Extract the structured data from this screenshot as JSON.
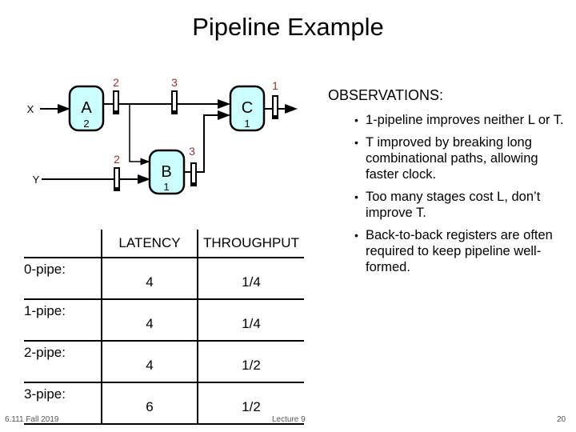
{
  "slide": {
    "title": "Pipeline Example",
    "footer": {
      "course": "6.111 Fall 2019",
      "lecture": "Lecture 9",
      "page": "20"
    }
  },
  "diagram": {
    "inputs": [
      {
        "id": "X",
        "label": "X"
      },
      {
        "id": "Y",
        "label": "Y"
      }
    ],
    "blocks": [
      {
        "id": "A",
        "label": "A",
        "delay": "2"
      },
      {
        "id": "B",
        "label": "B",
        "delay": "1"
      },
      {
        "id": "C",
        "label": "C",
        "delay": "1"
      }
    ],
    "registers": [
      {
        "id": "reg-after-a",
        "stage_label": "2"
      },
      {
        "id": "reg-a-to-c",
        "stage_label": "3"
      },
      {
        "id": "reg-after-c",
        "stage_label": "1"
      },
      {
        "id": "reg-y-input",
        "stage_label": "2"
      },
      {
        "id": "reg-after-b",
        "stage_label": "3"
      }
    ],
    "colors": {
      "block_fill": "#ccffff",
      "stage_label": "#993333",
      "wire": "#000000"
    }
  },
  "table": {
    "headers": [
      "",
      "LATENCY",
      "THROUGHPUT"
    ],
    "rows": [
      {
        "label": "0-pipe:",
        "latency": "4",
        "throughput": "1/4"
      },
      {
        "label": "1-pipe:",
        "latency": "4",
        "throughput": "1/4"
      },
      {
        "label": "2-pipe:",
        "latency": "4",
        "throughput": "1/2"
      },
      {
        "label": "3-pipe:",
        "latency": "6",
        "throughput": "1/2"
      }
    ]
  },
  "observations": {
    "title": "OBSERVATIONS:",
    "items": [
      "1-pipeline improves neither L or T.",
      "T improved by breaking long combinational paths, allowing faster clock.",
      "Too many stages cost L, don’t improve T.",
      "Back-to-back registers are often required to keep pipeline well-formed."
    ]
  }
}
